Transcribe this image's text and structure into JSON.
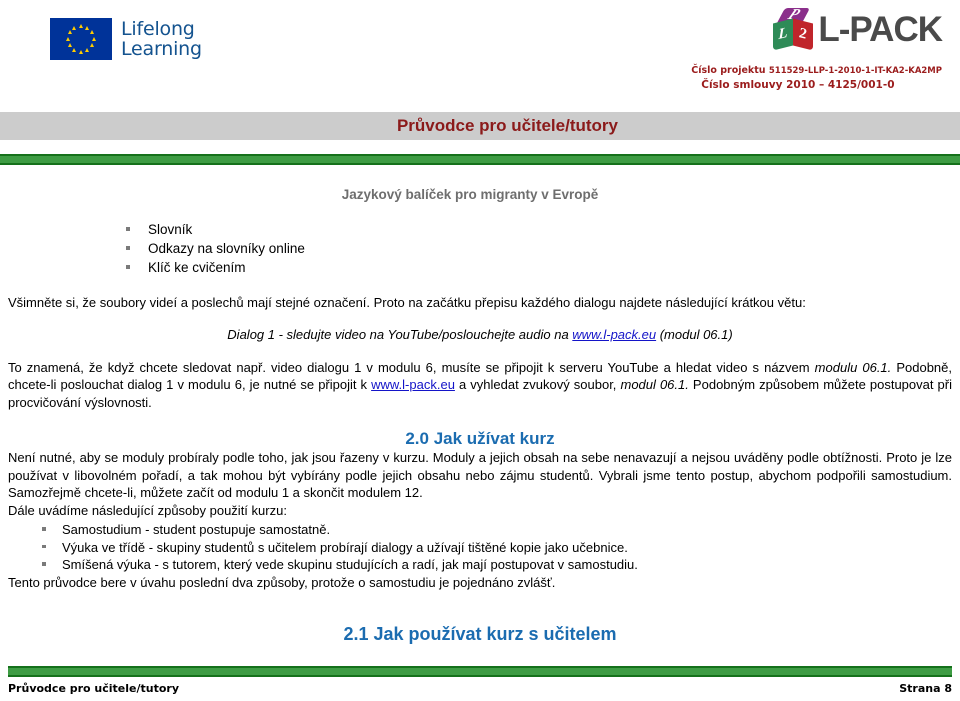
{
  "header": {
    "eu_logo_line1": "Lifelong",
    "eu_logo_line2": "Learning",
    "lpack_wordmark": "L-PACK",
    "cube_letters": {
      "top": "P",
      "left": "L",
      "right": "2"
    },
    "project_label": "Číslo projektu",
    "project_number": "511529-LLP-1-2010-1-IT-KA2-KA2MP",
    "contract_line": "Číslo smlouvy 2010 – 4125/001-0"
  },
  "title_band": {
    "title": "Průvodce pro učitele/tutory"
  },
  "subtitle": "Jazykový balíček pro migranty v Evropě",
  "top_bullets": [
    "Slovník",
    "Odkazy na slovníky online",
    "Klíč ke cvičením"
  ],
  "paragraphs": {
    "intro": "Všimněte si, že soubory videí a poslechů mají stejné označení. Proto na začátku přepisu každého dialogu najdete následující krátkou větu:",
    "dialog_prefix": "Dialog 1 - sledujte video na YouTube/poslouchejte audio na ",
    "dialog_link": "www.l-pack.eu",
    "dialog_suffix": " (modul 06.1)",
    "means_part1": "To znamená, že když chcete sledovat např. video dialogu 1 v modulu 6, musíte se připojit k serveru YouTube a hledat video s názvem ",
    "means_italic1": "modulu 06.1.",
    "means_part2": " Podobně, chcete-li poslouchat dialog 1 v modulu 6, je nutné se připojit k ",
    "means_link": "www.l-pack.eu",
    "means_part3": " a vyhledat zvukový soubor, ",
    "means_italic2": "modul 06.1.",
    "means_part4": " Podobným způsobem můžete postupovat při procvičování výslovnosti."
  },
  "section_20": {
    "heading": "2.0 Jak užívat kurz",
    "body": "Není nutné, aby se moduly probíraly podle toho, jak jsou řazeny v kurzu. Moduly a jejich obsah na sebe nenavazují a nejsou uváděny podle obtížnosti.  Proto je lze používat v libovolném pořadí, a tak mohou být vybírány podle jejich obsahu nebo zájmu studentů. Vybrali jsme tento postup, abychom podpořili samostudium. Samozřejmě chcete-li, můžete začít od modulu 1 a skončit modulem 12.",
    "list_intro": "Dále uvádíme následující způsoby použití kurzu:",
    "bullets": [
      "Samostudium - student postupuje samostatně.",
      "Výuka ve třídě - skupiny studentů s učitelem probírají dialogy a užívají tištěné kopie jako učebnice.",
      "Smíšená výuka - s tutorem, který vede skupinu studujících a radí, jak mají postupovat v samostudiu."
    ],
    "closing": "Tento průvodce bere v úvahu poslední dva způsoby, protože o samostudiu je pojednáno zvlášť."
  },
  "section_21": {
    "heading": "2.1 Jak používat kurz s učitelem"
  },
  "footer": {
    "left": "Průvodce pro učitele/tutory",
    "right": "Strana 8"
  },
  "colors": {
    "eu_blue": "#003399",
    "eu_star": "#FFCC00",
    "lifelong_text": "#14538F",
    "band_bg": "#CCCCCC",
    "title_red": "#8B1A1A",
    "rule_green": "#3E9C44",
    "heading_blue": "#1B6CB0",
    "link_blue": "#1414C8",
    "project_red": "#9B1C1C"
  }
}
